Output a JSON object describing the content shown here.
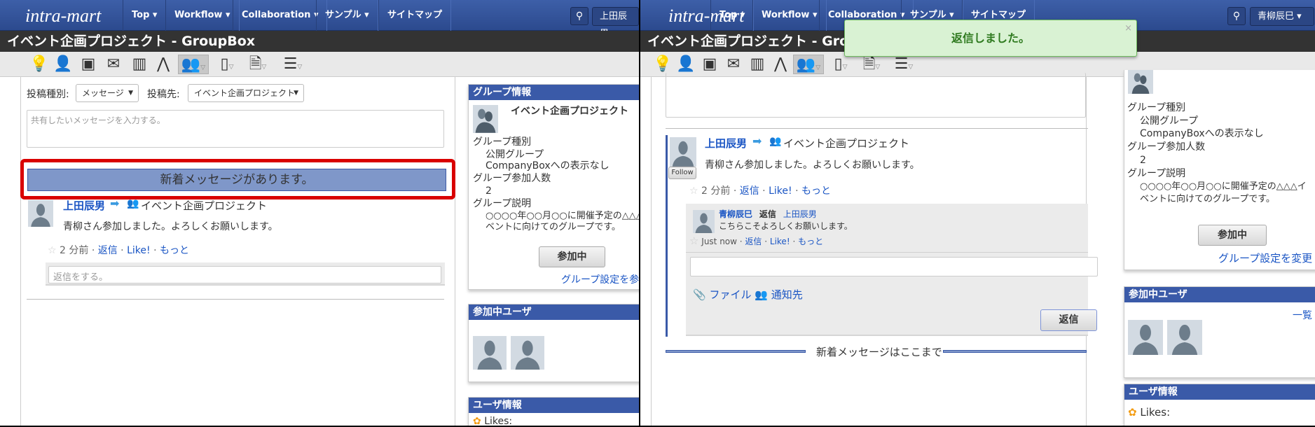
{
  "nav": {
    "logo": "intra-mart",
    "items": [
      "Top ▾",
      "Workflow ▾",
      "Collaboration ▾",
      "サンプル ▾",
      "サイトマップ"
    ]
  },
  "left": {
    "user_menu": "上田辰男",
    "title": "イベント企画プロジェクト - GroupBox",
    "post_type_label": "投稿種別:",
    "post_type_value": "メッセージ",
    "post_to_label": "投稿先:",
    "post_to_value": "イベント企画プロジェクト",
    "message_placeholder": "共有したいメッセージを入力する。",
    "new_message_notice": "新着メッセージがあります。",
    "post": {
      "author": "上田辰男",
      "target": "イベント企画プロジェクト",
      "body": "青柳さん参加しました。よろしくお願いします。",
      "time": "2 分前",
      "reply": "返信",
      "like": "Like!",
      "more": "もっと"
    },
    "reply_placeholder": "返信をする。"
  },
  "right": {
    "user_menu": "青柳辰巳 ▾",
    "title": "イベント企画プロジェクト - GroupBox",
    "toast": "返信しました。",
    "toast_close": "×",
    "post": {
      "author": "上田辰男",
      "target": "イベント企画プロジェクト",
      "body": "青柳さん参加しました。よろしくお願いします。",
      "follow": "Follow",
      "time": "2 分前",
      "reply": "返信",
      "like": "Like!",
      "more": "もっと"
    },
    "reply_item": {
      "author": "青柳辰巳",
      "action": "返信",
      "to": "上田辰男",
      "body": "こちらこそよろしくお願いします。",
      "time": "Just now",
      "reply": "返信",
      "like": "Like!",
      "more": "もっと"
    },
    "file_label": "ファイル",
    "notify_label": "通知先",
    "reply_button": "返信",
    "new_messages_end": "新着メッセージはここまで"
  },
  "sidebar": {
    "group_info_title": "グループ情報",
    "group_name": "イベント企画プロジェクト",
    "group_type_label": "グループ種別",
    "group_type_value": "公開グループ",
    "group_type_note": "CompanyBoxへの表示なし",
    "member_count_label": "グループ参加人数",
    "member_count": "2",
    "desc_label": "グループ説明",
    "desc_line1": "○○○○年○○月○○に開催予定の△△△イ",
    "desc_line2": "ベントに向けてのグループです。",
    "joined_button": "参加中",
    "settings_link_left": "グループ設定を参照",
    "settings_link_right": "グループ設定を変更",
    "members_title": "参加中ユーザ",
    "members_list_link": "一覧",
    "user_info_title": "ユーザ情報",
    "likes_label": "Likes:"
  },
  "colors": {
    "nav": "#2c4a8e",
    "highlight": "#d90000",
    "new_bar": "#7f97c9",
    "toast_bg": "#d9f2d3"
  }
}
